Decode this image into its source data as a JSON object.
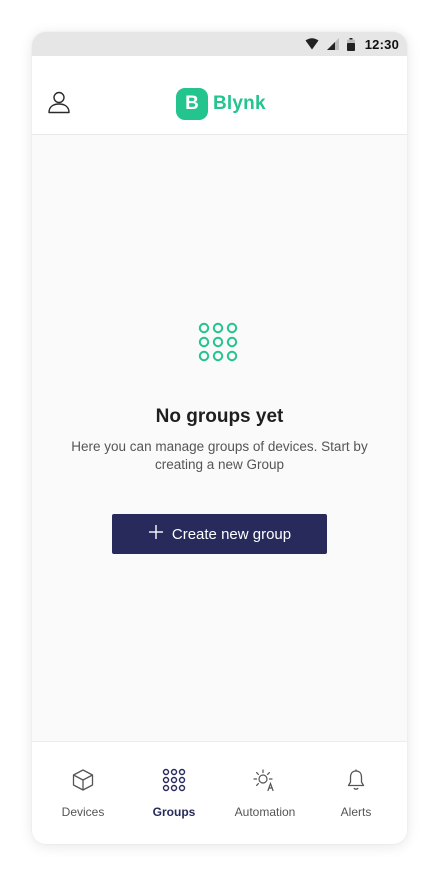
{
  "statusbar": {
    "time": "12:30",
    "icons": [
      "wifi-icon",
      "cellular-signal-icon",
      "battery-icon"
    ]
  },
  "header": {
    "logo_letter": "B",
    "logo_text": "Blynk",
    "profile_icon": "user-icon"
  },
  "empty_state": {
    "icon": "groups-grid-icon",
    "title": "No groups yet",
    "description": "Here you can manage groups of devices. Start by creating a new Group",
    "button_label": "Create new group",
    "button_icon": "plus-icon"
  },
  "bottom_nav": {
    "active": "Groups",
    "items": [
      {
        "label": "Devices",
        "icon": "cube-icon"
      },
      {
        "label": "Groups",
        "icon": "grid-dots-icon"
      },
      {
        "label": "Automation",
        "icon": "sun-automation-icon"
      },
      {
        "label": "Alerts",
        "icon": "bell-icon"
      }
    ]
  },
  "colors": {
    "brand_green": "#23c48e",
    "primary_navy": "#272a5a",
    "statusbar_bg": "#e6e6e6",
    "content_bg": "#fafafa"
  }
}
